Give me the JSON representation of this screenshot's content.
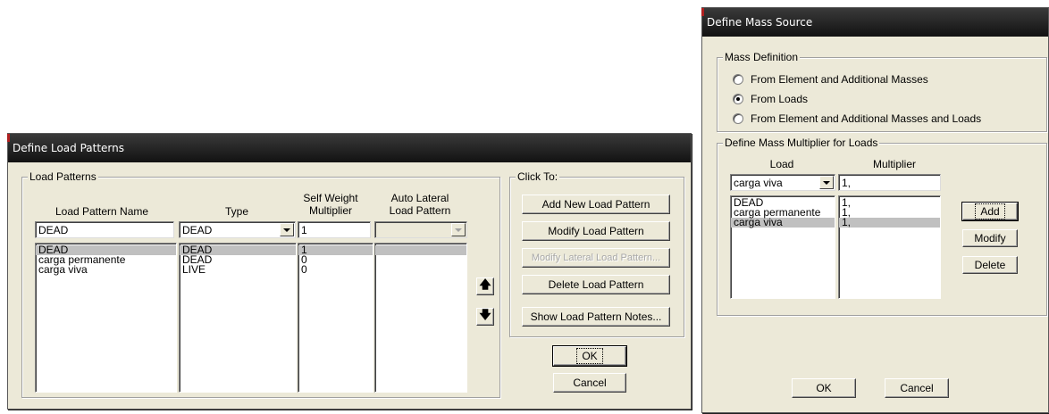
{
  "load_patterns_dialog": {
    "title": "Define Load Patterns",
    "group_label": "Load Patterns",
    "columns": {
      "name": "Load Pattern Name",
      "type": "Type",
      "self_weight_1": "Self Weight",
      "self_weight_2": "Multiplier",
      "auto_lateral_1": "Auto Lateral",
      "auto_lateral_2": "Load Pattern"
    },
    "input": {
      "name": "DEAD",
      "type": "DEAD",
      "multiplier": "1",
      "auto_lateral": ""
    },
    "rows": [
      {
        "name": "DEAD",
        "type": "DEAD",
        "multiplier": "1",
        "selected": true
      },
      {
        "name": "carga permanente",
        "type": "DEAD",
        "multiplier": "0",
        "selected": false
      },
      {
        "name": "carga viva",
        "type": "LIVE",
        "multiplier": "0",
        "selected": false
      }
    ],
    "move_up_icon": "arrow-up-icon",
    "move_down_icon": "arrow-down-icon",
    "click_to_label": "Click To:",
    "buttons": {
      "add": "Add New Load Pattern",
      "modify": "Modify Load Pattern",
      "modify_lateral": "Modify Lateral Load Pattern...",
      "delete": "Delete Load Pattern",
      "notes": "Show Load Pattern Notes...",
      "ok": "OK",
      "cancel": "Cancel"
    }
  },
  "mass_source_dialog": {
    "title": "Define Mass Source",
    "mass_definition_label": "Mass Definition",
    "options": [
      {
        "label": "From Element and Additional Masses",
        "selected": false
      },
      {
        "label": "From Loads",
        "selected": true
      },
      {
        "label": "From Element and Additional Masses and Loads",
        "selected": false
      }
    ],
    "multiplier_group_label": "Define Mass Multiplier for Loads",
    "col_load": "Load",
    "col_multiplier": "Multiplier",
    "input": {
      "load": "carga viva",
      "multiplier": "1,"
    },
    "rows": [
      {
        "load": "DEAD",
        "multiplier": "1,",
        "selected": false
      },
      {
        "load": "carga permanente",
        "multiplier": "1,",
        "selected": false
      },
      {
        "load": "carga viva",
        "multiplier": "1,",
        "selected": true
      }
    ],
    "buttons": {
      "add": "Add",
      "modify": "Modify",
      "delete": "Delete",
      "ok": "OK",
      "cancel": "Cancel"
    }
  }
}
